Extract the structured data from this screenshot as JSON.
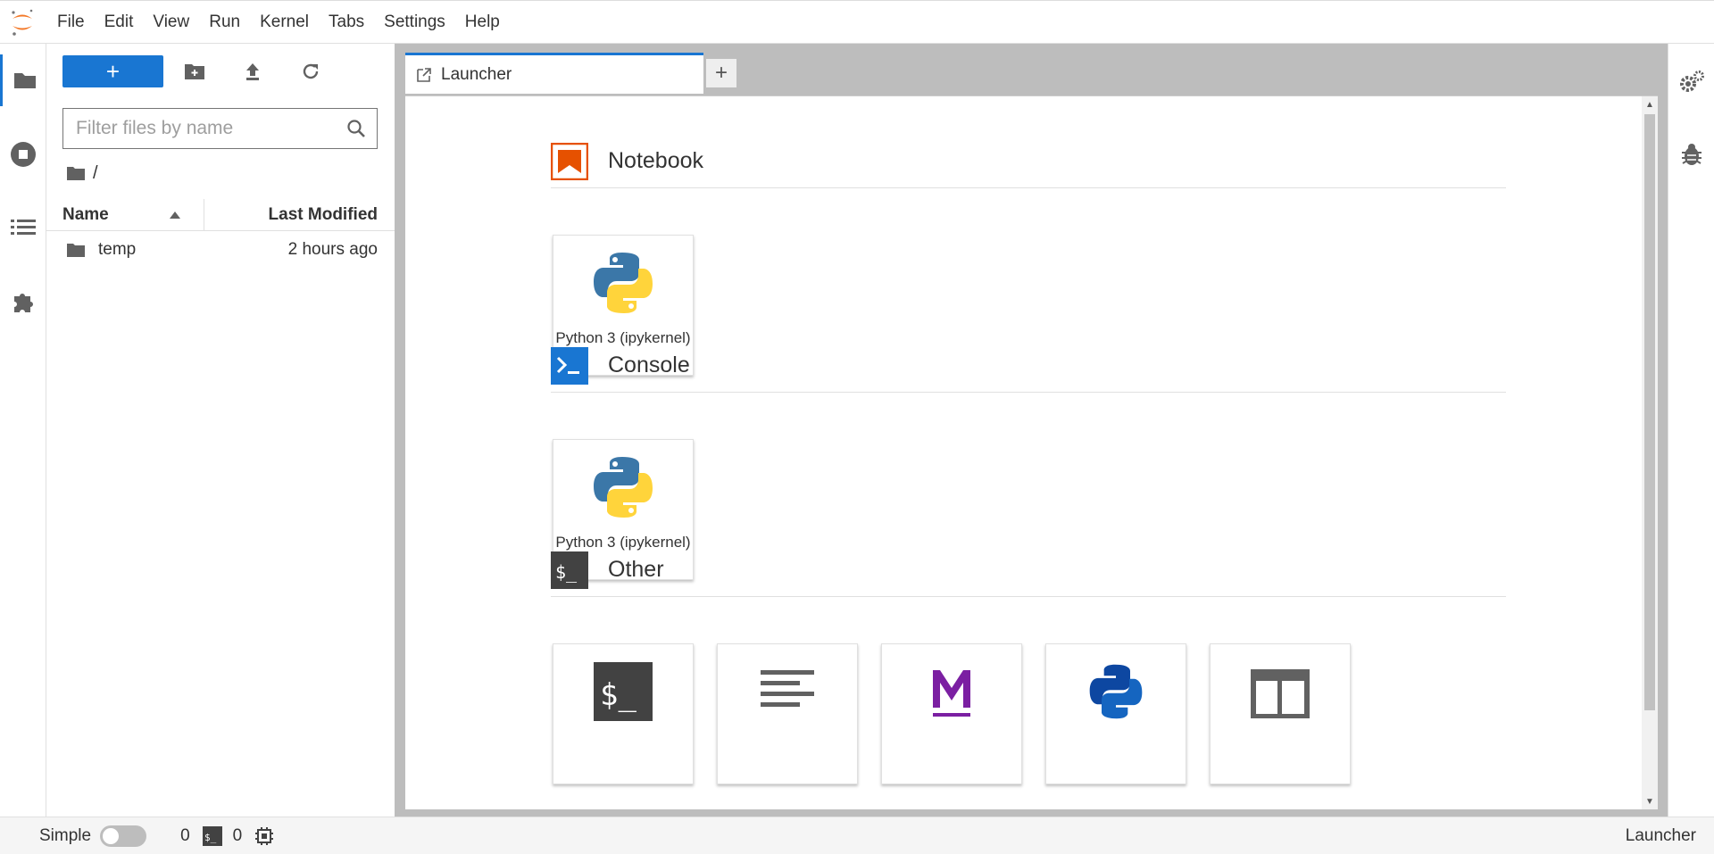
{
  "menu": [
    "File",
    "Edit",
    "View",
    "Run",
    "Kernel",
    "Tabs",
    "Settings",
    "Help"
  ],
  "filebrowser": {
    "filter_placeholder": "Filter files by name",
    "breadcrumb": "/",
    "col_name": "Name",
    "col_modified": "Last Modified",
    "files": [
      {
        "name": "temp",
        "modified": "2 hours ago",
        "icon": "folder-icon"
      }
    ]
  },
  "tab": {
    "label": "Launcher"
  },
  "launcher": {
    "notebook": {
      "title": "Notebook",
      "cards": [
        {
          "label": "Python 3 (ipykernel)"
        }
      ]
    },
    "console": {
      "title": "Console",
      "cards": [
        {
          "label": "Python 3 (ipykernel)"
        }
      ]
    },
    "other": {
      "title": "Other"
    }
  },
  "status": {
    "mode_label": "Simple",
    "kernels_count": "0",
    "terminals_count": "0",
    "right_label": "Launcher"
  },
  "colors": {
    "accent": "#1976d2",
    "notebook_orange": "#e65100",
    "markdown_purple": "#7b1fa2"
  }
}
